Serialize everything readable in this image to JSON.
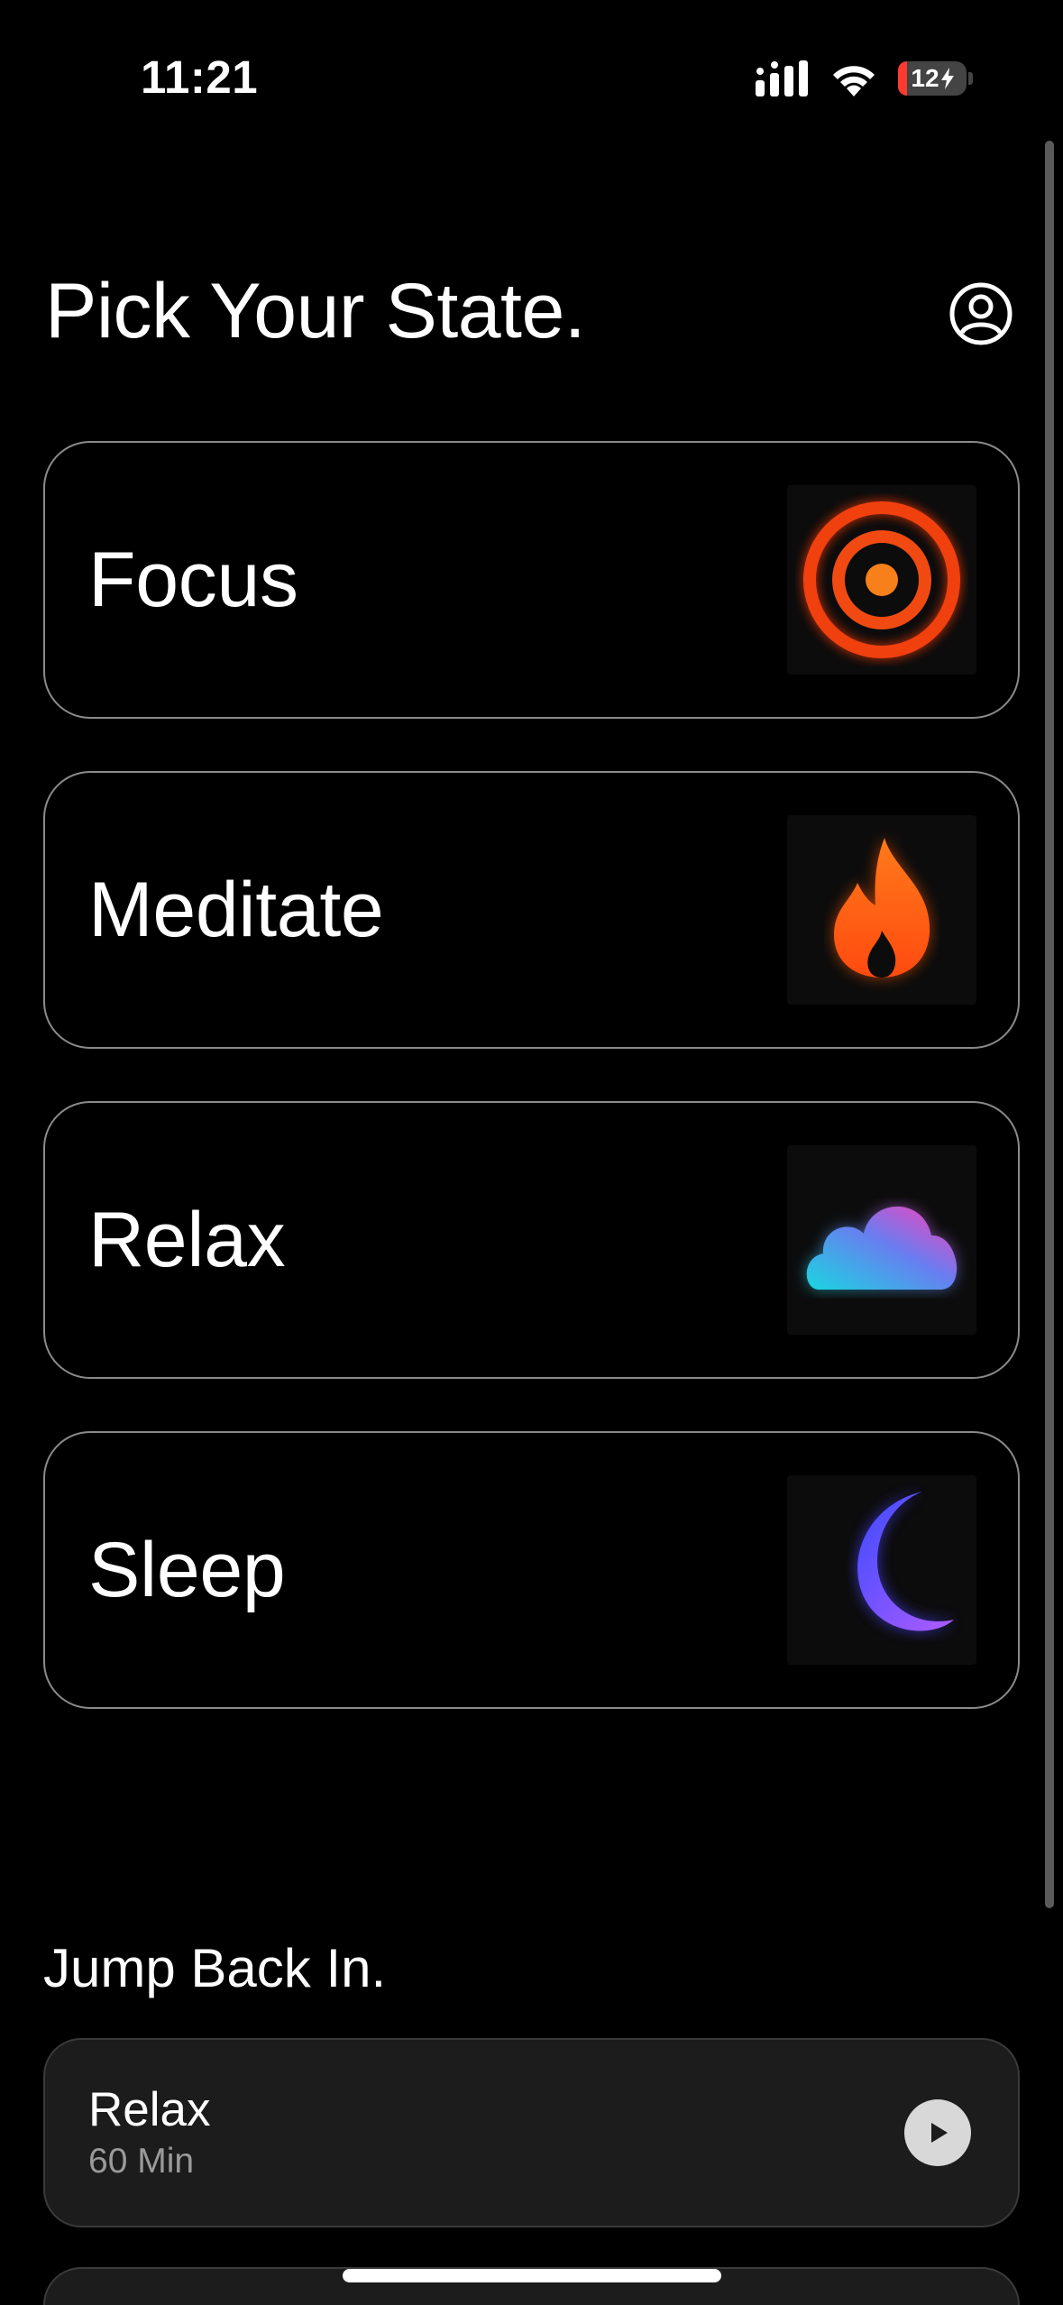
{
  "status_bar": {
    "time": "11:21",
    "battery_level": "12",
    "battery_low_color": "#ff3b30"
  },
  "header": {
    "title": "Pick Your State.",
    "profile_icon": "person-circle-icon"
  },
  "states": [
    {
      "label": "Focus",
      "icon": "target-icon",
      "accent": "#ff4a14"
    },
    {
      "label": "Meditate",
      "icon": "flame-icon",
      "accent": "#ff6a1a"
    },
    {
      "label": "Relax",
      "icon": "cloud-icon",
      "accent": "#29d3e6"
    },
    {
      "label": "Sleep",
      "icon": "moon-icon",
      "accent": "#5b4dff"
    }
  ],
  "jump_back_in": {
    "title": "Jump Back In.",
    "items": [
      {
        "title": "Relax",
        "duration": "60 Min",
        "action_icon": "play-icon"
      }
    ]
  }
}
